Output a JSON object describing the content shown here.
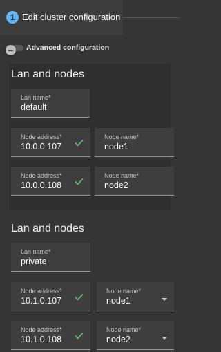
{
  "stepper": {
    "step_number": "1",
    "title": "Edit cluster configuration"
  },
  "advanced": {
    "label": "Advanced configuration",
    "enabled": false
  },
  "sections": [
    {
      "title": "Lan and nodes",
      "lan_name_label": "Lan name*",
      "lan_name_value": "default",
      "nodes": [
        {
          "address_label": "Node address*",
          "address": "10.0.0.107",
          "name_label": "Node name*",
          "name": "node1"
        },
        {
          "address_label": "Node address*",
          "address": "10.0.0.108",
          "name_label": "Node name*",
          "name": "node2"
        }
      ]
    },
    {
      "title": "Lan and nodes",
      "lan_name_label": "Lan name*",
      "lan_name_value": "private",
      "nodes": [
        {
          "address_label": "Node address*",
          "address": "10.1.0.107",
          "name_label": "Node name*",
          "name": "node1"
        },
        {
          "address_label": "Node address*",
          "address": "10.1.0.108",
          "name_label": "Node name*",
          "name": "node2"
        }
      ]
    }
  ],
  "colors": {
    "accent": "#64b5f6",
    "valid_check": "#66bb6a",
    "background": "#353535"
  },
  "icons": {
    "valid": "check-icon",
    "dropdown": "caret-down-icon"
  }
}
